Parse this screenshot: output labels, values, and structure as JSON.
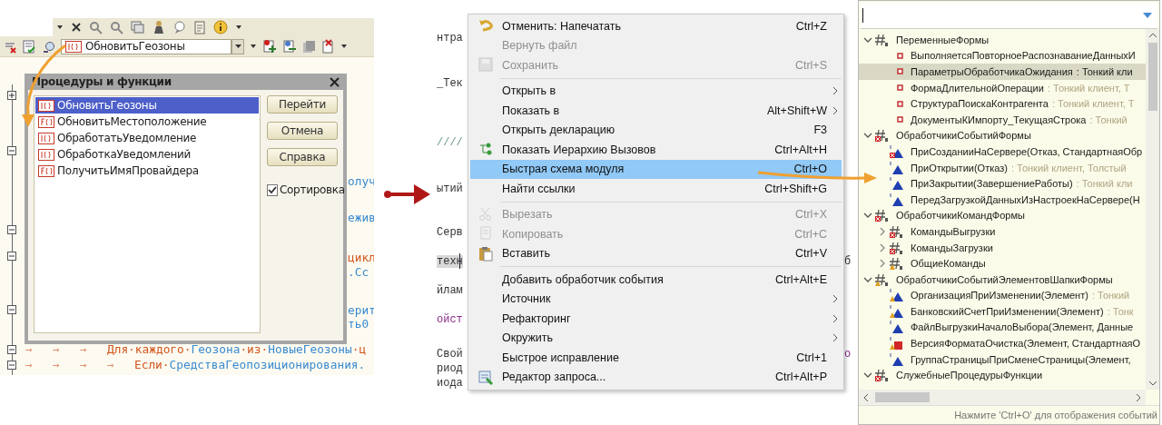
{
  "left_window": {
    "procedure_combo": {
      "kind": "procedure",
      "value": "ОбновитьГеозоны"
    },
    "dialog": {
      "title": "Процедуры и функции",
      "items": [
        {
          "kind": "procedure",
          "label": "ОбновитьГеозоны",
          "selected": true
        },
        {
          "kind": "function",
          "label": "ОбновитьМестоположение",
          "selected": false
        },
        {
          "kind": "procedure",
          "label": "ОбработатьУведомление",
          "selected": false
        },
        {
          "kind": "procedure",
          "label": "ОбработкаУведомлений",
          "selected": false
        },
        {
          "kind": "function",
          "label": "ПолучитьИмяПровайдера",
          "selected": false
        }
      ],
      "buttons": [
        "Перейти",
        "Отмена",
        "Справка"
      ],
      "sort_checkbox": {
        "label": "Сортировка",
        "checked": true
      }
    },
    "fold_markers": [
      {
        "expanded": false
      },
      {
        "expanded": true
      },
      {
        "expanded": true
      },
      {
        "expanded": true
      },
      {
        "expanded": true
      },
      {
        "expanded": true
      },
      {
        "expanded": true
      }
    ],
    "code_fragments": [
      {
        "kind": "identifier",
        "text": "олуч"
      },
      {
        "kind": "identifier",
        "text": "ежив"
      },
      {
        "kind": "keyword",
        "text": "цикл"
      },
      {
        "kind": "identifier",
        "text": ".Сс"
      },
      {
        "kind": "identifier",
        "text": "ерит"
      },
      {
        "kind": "identifier",
        "text": "ть0"
      }
    ],
    "code_lines": [
      [
        {
          "kind": "tab",
          "text": "→"
        },
        {
          "kind": "tab",
          "text": "→"
        },
        {
          "kind": "tab",
          "text": "→"
        },
        {
          "kind": "keyword",
          "text": "Для·каждого·"
        },
        {
          "kind": "identifier",
          "text": "Геозона"
        },
        {
          "kind": "keyword",
          "text": "·из·"
        },
        {
          "kind": "identifier",
          "text": "НовыеГеозоны"
        },
        {
          "kind": "keyword",
          "text": "·ц"
        }
      ],
      [
        {
          "kind": "tab",
          "text": "→"
        },
        {
          "kind": "tab",
          "text": "→"
        },
        {
          "kind": "tab",
          "text": "→"
        },
        {
          "kind": "tab",
          "text": "→"
        },
        {
          "kind": "keyword",
          "text": "Если·"
        },
        {
          "kind": "identifier",
          "text": "СредстваГеопозиционирования."
        }
      ]
    ]
  },
  "editor_background": [
    {
      "kind": "plain",
      "text": "нтра"
    },
    {
      "kind": "plain",
      "text": "_Тек"
    },
    {
      "kind": "comment",
      "text": "////"
    },
    {
      "kind": "plain",
      "text": "ытий"
    },
    {
      "kind": "plain",
      "text": "Серв"
    },
    {
      "kind": "highlighted",
      "text": "техн"
    },
    {
      "kind": "plain",
      "text": "йлам"
    },
    {
      "kind": "purple",
      "text": "ойст"
    },
    {
      "kind": "plain",
      "text": "Свой"
    },
    {
      "kind": "plain",
      "text": "риод"
    },
    {
      "kind": "plain",
      "text": "иода"
    },
    {
      "kind": "plain",
      "text": "б"
    },
    {
      "kind": "purple",
      "text": "о"
    }
  ],
  "context_menu": {
    "items": [
      {
        "kind": "item",
        "label": "Отменить: Напечатать",
        "shortcut": "Ctrl+Z",
        "disabled": false,
        "selected": false,
        "submenu": false
      },
      {
        "kind": "item",
        "label": "Вернуть файл",
        "disabled": true,
        "selected": false,
        "submenu": false
      },
      {
        "kind": "item",
        "label": "Сохранить",
        "shortcut": "Ctrl+S",
        "disabled": true,
        "selected": false,
        "submenu": false
      },
      {
        "kind": "separator"
      },
      {
        "kind": "item",
        "label": "Открыть в",
        "disabled": false,
        "selected": false,
        "submenu": true
      },
      {
        "kind": "item",
        "label": "Показать в",
        "shortcut": "Alt+Shift+W",
        "disabled": false,
        "selected": false,
        "submenu": true
      },
      {
        "kind": "item",
        "label": "Открыть декларацию",
        "shortcut": "F3",
        "disabled": false,
        "selected": false,
        "submenu": false
      },
      {
        "kind": "item",
        "label": "Показать Иерархию Вызовов",
        "shortcut": "Ctrl+Alt+H",
        "disabled": false,
        "selected": false,
        "submenu": false
      },
      {
        "kind": "item",
        "label": "Быстрая схема модуля",
        "shortcut": "Ctrl+O",
        "disabled": false,
        "selected": true,
        "submenu": false
      },
      {
        "kind": "item",
        "label": "Найти ссылки",
        "shortcut": "Ctrl+Shift+G",
        "disabled": false,
        "selected": false,
        "submenu": false
      },
      {
        "kind": "separator"
      },
      {
        "kind": "item",
        "label": "Вырезать",
        "shortcut": "Ctrl+X",
        "disabled": true,
        "selected": false,
        "submenu": false
      },
      {
        "kind": "item",
        "label": "Копировать",
        "shortcut": "Ctrl+C",
        "disabled": true,
        "selected": false,
        "submenu": false
      },
      {
        "kind": "item",
        "label": "Вставить",
        "shortcut": "Ctrl+V",
        "disabled": false,
        "selected": false,
        "submenu": false
      },
      {
        "kind": "separator"
      },
      {
        "kind": "item",
        "label": "Добавить обработчик события",
        "shortcut": "Ctrl+Alt+E",
        "disabled": false,
        "selected": false,
        "submenu": false
      },
      {
        "kind": "item",
        "label": "Источник",
        "disabled": false,
        "selected": false,
        "submenu": true
      },
      {
        "kind": "item",
        "label": "Рефакторинг",
        "disabled": false,
        "selected": false,
        "submenu": true
      },
      {
        "kind": "item",
        "label": "Окружить",
        "disabled": false,
        "selected": false,
        "submenu": true
      },
      {
        "kind": "item",
        "label": "Быстрое исправление",
        "shortcut": "Ctrl+1",
        "disabled": false,
        "selected": false,
        "submenu": false
      },
      {
        "kind": "item",
        "label": "Редактор запроса...",
        "shortcut": "Ctrl+Alt+P",
        "disabled": false,
        "selected": false,
        "submenu": false
      }
    ]
  },
  "outline": {
    "tree": [
      {
        "kind": "group",
        "label": "ПеременныеФормы",
        "error": false,
        "warning": false,
        "expanded": true,
        "selected": false,
        "children": [
          {
            "kind": "variable",
            "label": "ВыполняетсяПовторноеРаспознаваниеДанныхИ",
            "error": false,
            "warning": false,
            "selected": false
          },
          {
            "kind": "variable",
            "label": "ПараметрыОбработчикаОжидания",
            "detail": ": Тонкий кли",
            "error": false,
            "warning": false,
            "selected": true
          },
          {
            "kind": "variable",
            "label": "ФормаДлительнойОперации",
            "detail": ": Тонкий клиент, Т",
            "error": false,
            "warning": false,
            "selected": false
          },
          {
            "kind": "variable",
            "label": "СтруктураПоискаКонтрагента",
            "detail": ": Тонкий клиент, Т",
            "error": false,
            "warning": false,
            "selected": false
          },
          {
            "kind": "variable",
            "label": "ДокументыКИмпорту_ТекущаяСтрока",
            "detail": ": Тонкий",
            "error": false,
            "warning": false,
            "selected": false
          }
        ]
      },
      {
        "kind": "group",
        "label": "ОбработчикиСобытийФормы",
        "error": true,
        "warning": false,
        "expanded": true,
        "selected": false,
        "children": [
          {
            "kind": "procedure",
            "label": "ПриСозданииНаСервере(Отказ, СтандартнаяОбр",
            "error": true,
            "warning": false,
            "selected": false
          },
          {
            "kind": "procedure",
            "label": "ПриОткрытии(Отказ)",
            "detail": ": Тонкий клиент, Толстый",
            "error": false,
            "warning": false,
            "selected": false
          },
          {
            "kind": "procedure",
            "label": "ПриЗакрытии(ЗавершениеРаботы)",
            "detail": ": Тонкий кли",
            "error": false,
            "warning": false,
            "selected": false
          },
          {
            "kind": "procedure",
            "label": "ПередЗагрузкойДанныхИзНастроекНаСервере(Н",
            "error": false,
            "warning": false,
            "selected": false
          }
        ]
      },
      {
        "kind": "group",
        "label": "ОбработчикиКомандФормы",
        "error": true,
        "warning": false,
        "expanded": true,
        "selected": false,
        "children": [
          {
            "kind": "group",
            "label": "КомандыВыгрузки",
            "error": true,
            "warning": false,
            "expanded": false,
            "selected": false
          },
          {
            "kind": "group",
            "label": "КомандыЗагрузки",
            "error": true,
            "warning": false,
            "expanded": false,
            "selected": false
          },
          {
            "kind": "group",
            "label": "ОбщиеКоманды",
            "error": false,
            "warning": true,
            "expanded": false,
            "selected": false
          }
        ]
      },
      {
        "kind": "group",
        "label": "ОбработчикиСобытийЭлементовШапкиФормы",
        "error": false,
        "warning": true,
        "expanded": true,
        "selected": false,
        "children": [
          {
            "kind": "procedure",
            "label": "ОрганизацияПриИзменении(Элемент)",
            "detail": ": Тонкий",
            "error": false,
            "warning": true,
            "selected": false
          },
          {
            "kind": "procedure",
            "label": "БанковскийСчетПриИзменении(Элемент)",
            "detail": ": Тонк",
            "error": false,
            "warning": true,
            "selected": false
          },
          {
            "kind": "procedure",
            "label": "ФайлВыгрузкиНачалоВыбора(Элемент, Данные",
            "error": false,
            "warning": false,
            "selected": false
          },
          {
            "kind": "function",
            "label": "ВерсияФорматаОчистка(Элемент, СтандартнаяО",
            "error": false,
            "warning": true,
            "selected": false
          },
          {
            "kind": "procedure",
            "label": "ГруппаСтраницыПриСменеСтраницы(Элемент,",
            "error": false,
            "warning": false,
            "selected": false
          }
        ]
      },
      {
        "kind": "group",
        "label": "СлужебныеПроцедурыФункции",
        "error": true,
        "warning": false,
        "expanded": true,
        "selected": false
      }
    ],
    "status": "Нажмите 'Ctrl+O' для отображения событий"
  }
}
